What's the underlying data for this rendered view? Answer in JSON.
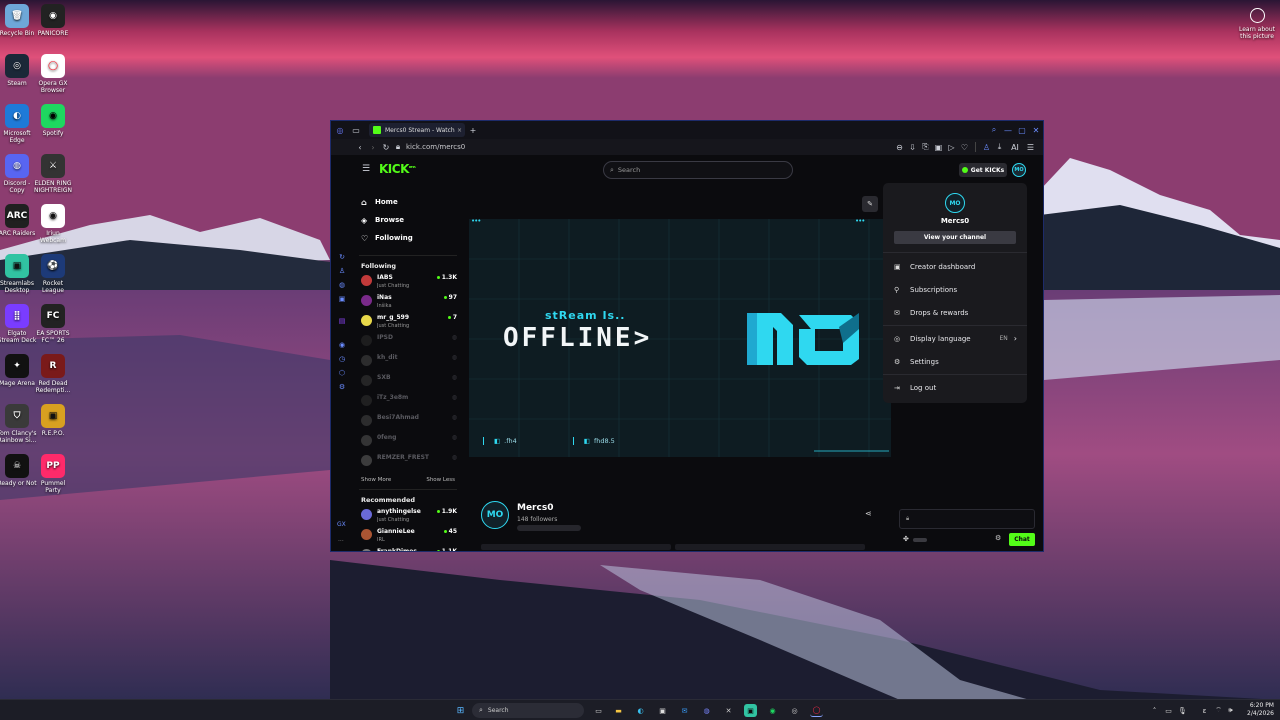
{
  "desktop": {
    "icons": [
      {
        "label": "Recycle Bin"
      },
      {
        "label": "PANICORE"
      },
      {
        "label": "Steam"
      },
      {
        "label": "Opera GX Browser"
      },
      {
        "label": "Microsoft Edge"
      },
      {
        "label": "Spotify"
      },
      {
        "label": "Discord - Copy"
      },
      {
        "label": "ELDEN RING NIGHTREIGN"
      },
      {
        "label": "ARC Raiders"
      },
      {
        "label": "Iriun Webcam"
      },
      {
        "label": "Streamlabs Desktop"
      },
      {
        "label": "Rocket League"
      },
      {
        "label": "Elgato Stream Deck"
      },
      {
        "label": "EA SPORTS FC™ 26"
      },
      {
        "label": "Mage Arena"
      },
      {
        "label": "Red Dead Redempti..."
      },
      {
        "label": "Tom Clancy's Rainbow Si..."
      },
      {
        "label": "R.E.P.O."
      },
      {
        "label": "Ready or Not"
      },
      {
        "label": "Pummel Party"
      }
    ],
    "learn_about": "Learn about this picture"
  },
  "browser": {
    "tab_title": "Mercs0 Stream - Watch Li...",
    "url": "kick.com/mercs0",
    "ai_label": "AI"
  },
  "kick": {
    "logo": "KICK",
    "logo_badge": "BETA",
    "search_placeholder": "Search",
    "get_kicks": "Get KICKs",
    "nav": [
      {
        "label": "Home",
        "icon": "home-icon"
      },
      {
        "label": "Browse",
        "icon": "browse-icon"
      },
      {
        "label": "Following",
        "icon": "heart-icon"
      }
    ],
    "following_header": "Following",
    "following": [
      {
        "name": "IABS",
        "category": "Just Chatting",
        "viewers": "1.3K",
        "live": true,
        "color": "#c23a3a"
      },
      {
        "name": "iNas",
        "category": "Inšika",
        "viewers": "97",
        "live": true,
        "color": "#7a2a8a"
      },
      {
        "name": "mr_g_599",
        "category": "Just Chatting",
        "viewers": "7",
        "live": true,
        "color": "#e8d84a"
      },
      {
        "name": "IPSD",
        "category": "",
        "viewers": "",
        "live": false,
        "color": "#333"
      },
      {
        "name": "kh_dit",
        "category": "",
        "viewers": "",
        "live": false,
        "color": "#555"
      },
      {
        "name": "SXB",
        "category": "",
        "viewers": "",
        "live": false,
        "color": "#444"
      },
      {
        "name": "iTz_3e8m",
        "category": "",
        "viewers": "",
        "live": false,
        "color": "#3a3a3a"
      },
      {
        "name": "Besi7Ahmad",
        "category": "",
        "viewers": "",
        "live": false,
        "color": "#555"
      },
      {
        "name": "0feng",
        "category": "",
        "viewers": "",
        "live": false,
        "color": "#666"
      },
      {
        "name": "REMZER_FREST",
        "category": "",
        "viewers": "",
        "live": false,
        "color": "#777"
      }
    ],
    "show_more": "Show More",
    "show_less": "Show Less",
    "recommended_header": "Recommended",
    "recommended": [
      {
        "name": "anythingelse",
        "category": "Just Chatting",
        "viewers": "1.9K",
        "color": "#6a6ad8"
      },
      {
        "name": "GiannieLee",
        "category": "IRL",
        "viewers": "45",
        "color": "#aa5533"
      },
      {
        "name": "FrankDimes",
        "category": "",
        "viewers": "1.1K",
        "color": "#777"
      }
    ],
    "offline_top": "stReam Is..",
    "offline_main": "OFFLINE>",
    "player_badges": [
      ".fh4",
      "fhd8.5"
    ],
    "channel": {
      "name": "Mercs0",
      "followers": "148 followers"
    },
    "chat_button": "Chat",
    "menu": {
      "username": "Mercs0",
      "view_channel": "View your channel",
      "items": [
        {
          "label": "Creator dashboard",
          "icon": "dashboard-icon",
          "glyph": "▣"
        },
        {
          "label": "Subscriptions",
          "icon": "subscriptions-icon",
          "glyph": "⚲"
        },
        {
          "label": "Drops & rewards",
          "icon": "gift-icon",
          "glyph": "✉"
        },
        {
          "label": "Display language",
          "icon": "globe-icon",
          "glyph": "◎",
          "value": "EN"
        },
        {
          "label": "Settings",
          "icon": "gear-icon",
          "glyph": "⚙"
        },
        {
          "label": "Log out",
          "icon": "logout-icon",
          "glyph": "⇥"
        }
      ]
    }
  },
  "taskbar": {
    "search": "Search",
    "time": "6:20 PM",
    "date": "2/4/2026"
  },
  "colors": {
    "kick_green": "#53fc18",
    "accent_cyan": "#2fd8f0"
  }
}
